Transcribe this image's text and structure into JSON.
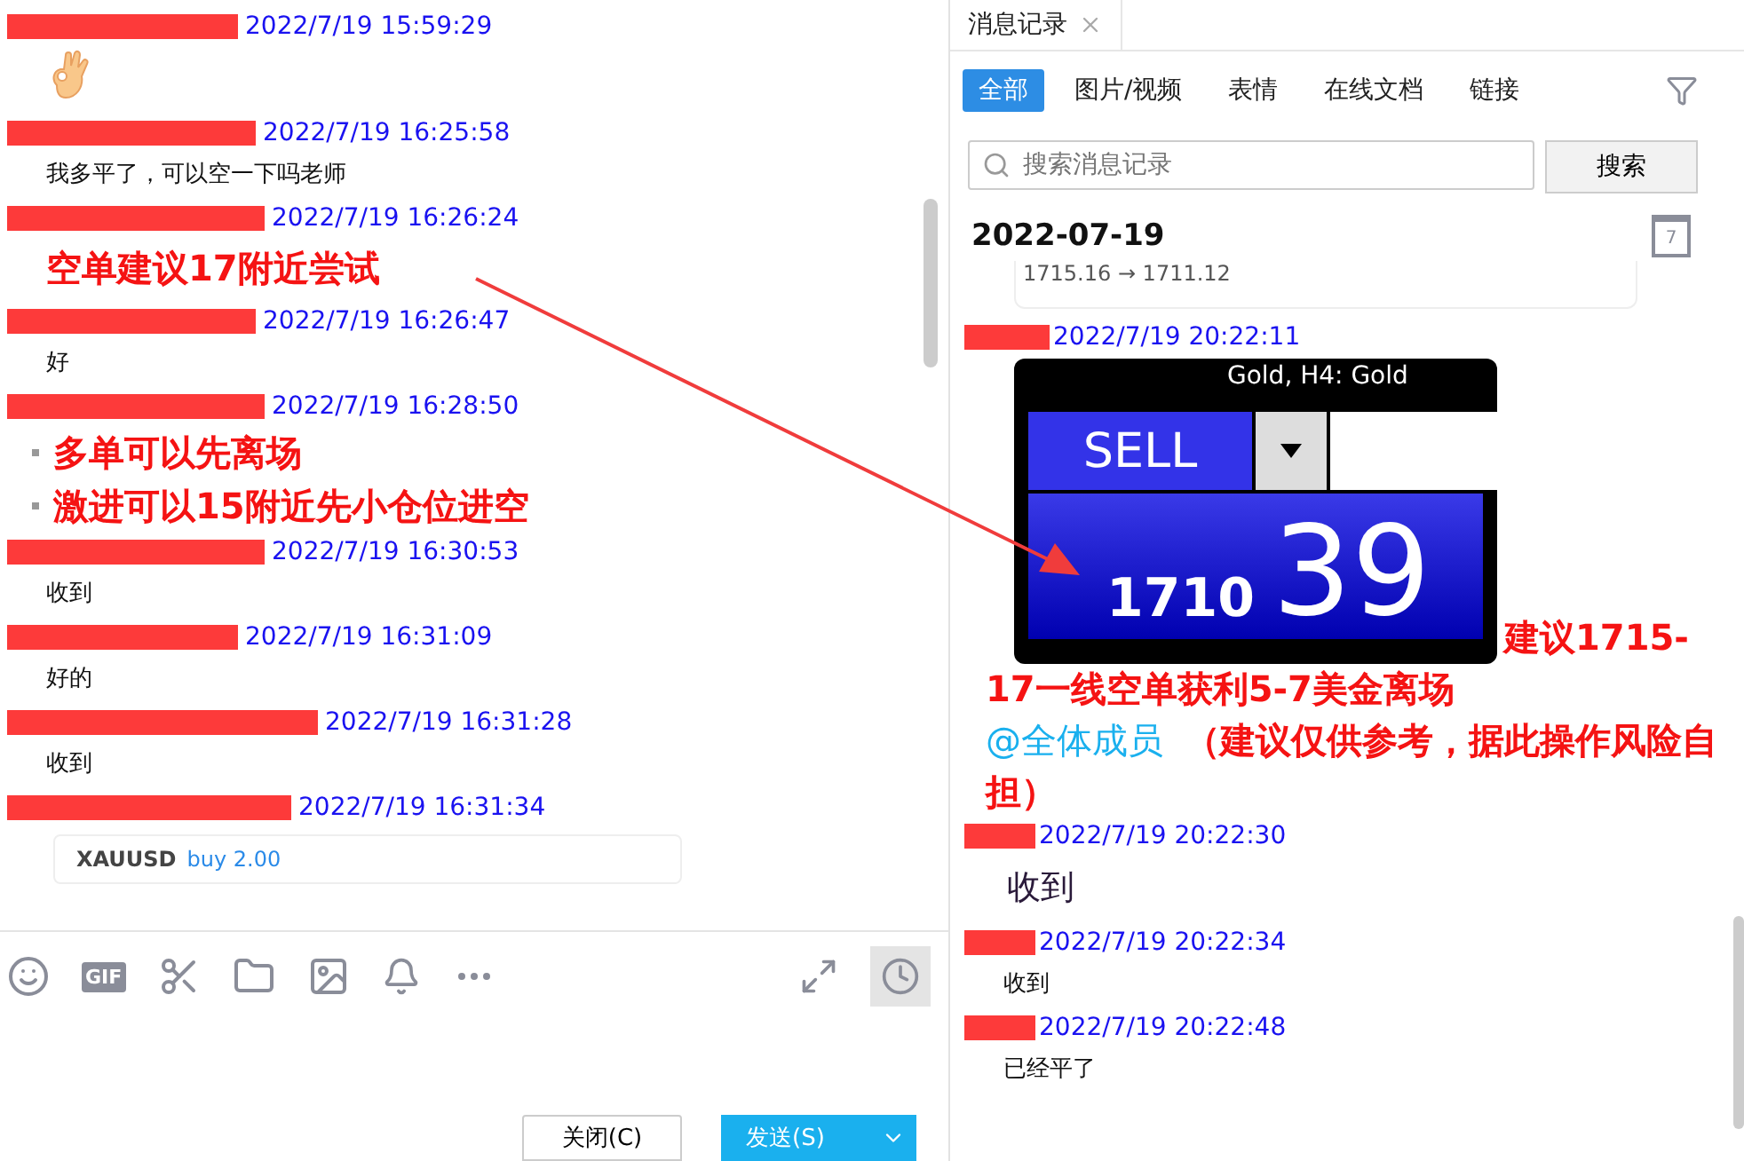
{
  "chat": {
    "messages": [
      {
        "time": "2022/7/19 15:59:29",
        "kind": "emoji"
      },
      {
        "time": "2022/7/19 16:25:58",
        "kind": "text",
        "text": "我多平了，可以空一下吗老师"
      },
      {
        "time": "2022/7/19 16:26:24",
        "kind": "highlight",
        "lines": [
          "空单建议17附近尝试"
        ]
      },
      {
        "time": "2022/7/19 16:26:47",
        "kind": "text",
        "text": "好"
      },
      {
        "time": "2022/7/19 16:28:50",
        "kind": "bullets",
        "lines": [
          "多单可以先离场",
          "激进可以15附近先小仓位进空"
        ]
      },
      {
        "time": "2022/7/19 16:30:53",
        "kind": "text",
        "text": "收到"
      },
      {
        "time": "2022/7/19 16:31:09",
        "kind": "text",
        "text": "好的"
      },
      {
        "time": "2022/7/19 16:31:28",
        "kind": "text",
        "text": "收到"
      },
      {
        "time": "2022/7/19 16:31:34",
        "kind": "card",
        "symbol": "XAUUSD",
        "order": "buy 2.00"
      }
    ],
    "toolbar": {
      "gif": "GIF"
    },
    "buttons": {
      "close": "关闭(C)",
      "send": "发送(S)"
    }
  },
  "history": {
    "tab": "消息记录",
    "filters": [
      {
        "label": "全部",
        "selected": true
      },
      {
        "label": "图片/视频",
        "selected": false
      },
      {
        "label": "表情",
        "selected": false
      },
      {
        "label": "在线文档",
        "selected": false
      },
      {
        "label": "链接",
        "selected": false
      }
    ],
    "search": {
      "placeholder": "搜索消息记录",
      "button": "搜索"
    },
    "date": "2022-07-19",
    "calendar_day": "7",
    "prev_card": "1715.16 → 1711.12",
    "messages": [
      {
        "time": "2022/7/19 20:22:11",
        "kind": "trade",
        "chart_title": "Gold, H4:  Gold",
        "side": "SELL",
        "price_main": "1710",
        "price_big": "39",
        "caption": "建议1715-17一线空单获利5-7美金离场",
        "mention": "@全体成员",
        "note": "（建议仅供参考，据此操作风险自担）"
      },
      {
        "time": "2022/7/19 20:22:30",
        "kind": "large",
        "text": "收到"
      },
      {
        "time": "2022/7/19 20:22:34",
        "kind": "text",
        "text": "收到"
      },
      {
        "time": "2022/7/19 20:22:48",
        "kind": "text",
        "text": "已经平了"
      }
    ]
  }
}
